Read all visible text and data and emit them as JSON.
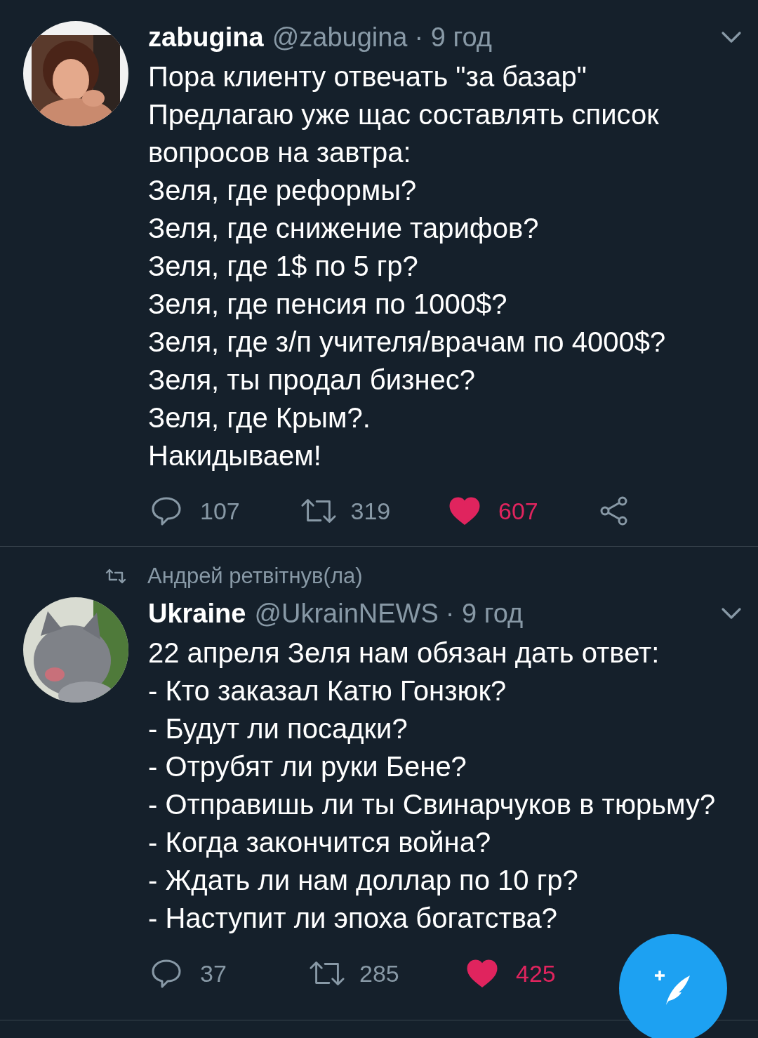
{
  "tweets": [
    {
      "name": "zabugina",
      "handle": "@zabugina",
      "time": "· 9 год",
      "lines": [
        "Пора клиенту отвечать \"за базар\"",
        "Предлагаю уже щас составлять список вопросов на завтра:",
        "Зеля, где реформы?",
        "Зеля, где снижение тарифов?",
        "Зеля, где 1$ по 5 гр?",
        "Зеля, где пенсия по 1000$?",
        "Зеля, где з/п учителя/врачам по 4000$?",
        "Зеля, ты продал бизнес?",
        "Зеля, где Крым?.",
        "Накидываем!"
      ],
      "replies": "107",
      "retweets": "319",
      "likes": "607",
      "liked": true,
      "share": true
    },
    {
      "retweeted_by": "Андрей ретвітнув(ла)",
      "name": "Ukraine",
      "handle": "@UkrainNEWS",
      "time": "· 9 год",
      "lines": [
        "22 апреля Зеля нам обязан дать ответ:",
        "- Кто заказал Катю Гонзюк?",
        "- Будут ли посадки?",
        "- Отрубят ли руки Бене?",
        "- Отправишь ли ты Свинарчуков в тюрьму?",
        "- Когда закончится война?",
        "- Ждать ли нам доллар по 10 гр?",
        "- Наступит ли эпоха богатства?"
      ],
      "replies": "37",
      "retweets": "285",
      "likes": "425",
      "liked": true,
      "share": false
    }
  ]
}
